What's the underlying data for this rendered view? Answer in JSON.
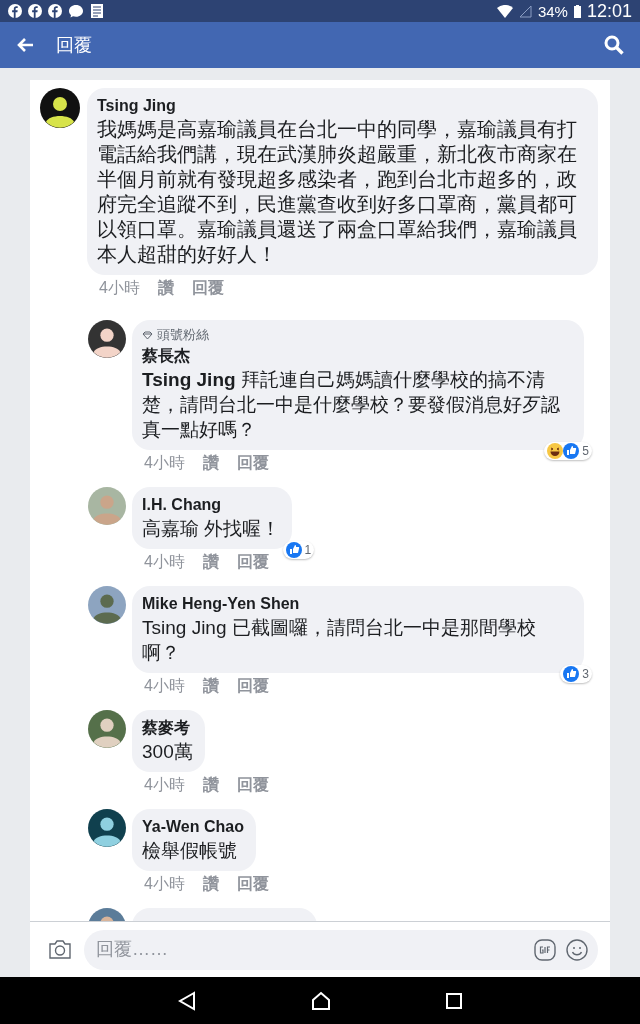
{
  "status_bar": {
    "battery": "34%",
    "time": "12:01"
  },
  "header": {
    "title": "回覆"
  },
  "comments": [
    {
      "name": "Tsing Jing",
      "text": "我媽媽是高嘉瑜議員在台北一中的同學，嘉瑜議員有打電話給我們講，現在武漢肺炎超嚴重，新北夜市商家在半個月前就有發現超多感染者，跑到台北市超多的，政府完全追蹤不到，民進黨查收到好多口罩商，黨員都可以領口罩。嘉瑜議員還送了兩盒口罩給我們，嘉瑜議員本人超甜的好好人！",
      "time": "4小時",
      "like": "讚",
      "reply": "回覆",
      "children": [
        {
          "badge": "頭號粉絲",
          "name": "蔡長杰",
          "text": "**Tsing Jing** 拜託連自己媽媽讀什麼學校的搞不清楚，請問台北一中是什麼學校？要發假消息好歹認真一點好嗎？",
          "time": "4小時",
          "like": "讚",
          "reply": "回覆",
          "reactions": {
            "haha": true,
            "count": "5"
          }
        },
        {
          "name": "I.H. Chang",
          "text": "高嘉瑜 外找喔！",
          "time": "4小時",
          "like": "讚",
          "reply": "回覆",
          "reactions": {
            "haha": false,
            "count": "1"
          }
        },
        {
          "name": "Mike Heng-Yen Shen",
          "text": "Tsing Jing 已截圖囉，請問台北一中是那間學校啊？",
          "time": "4小時",
          "like": "讚",
          "reply": "回覆",
          "reactions": {
            "haha": false,
            "count": "3"
          }
        },
        {
          "name": "蔡麥考",
          "text": "300萬",
          "time": "4小時",
          "like": "讚",
          "reply": "回覆"
        },
        {
          "name": "Ya-Wen Chao",
          "text": "檢舉假帳號",
          "time": "4小時",
          "like": "讚",
          "reply": "回覆"
        },
        {
          "kind": "cut"
        }
      ]
    }
  ],
  "composer": {
    "placeholder": "回覆……"
  }
}
